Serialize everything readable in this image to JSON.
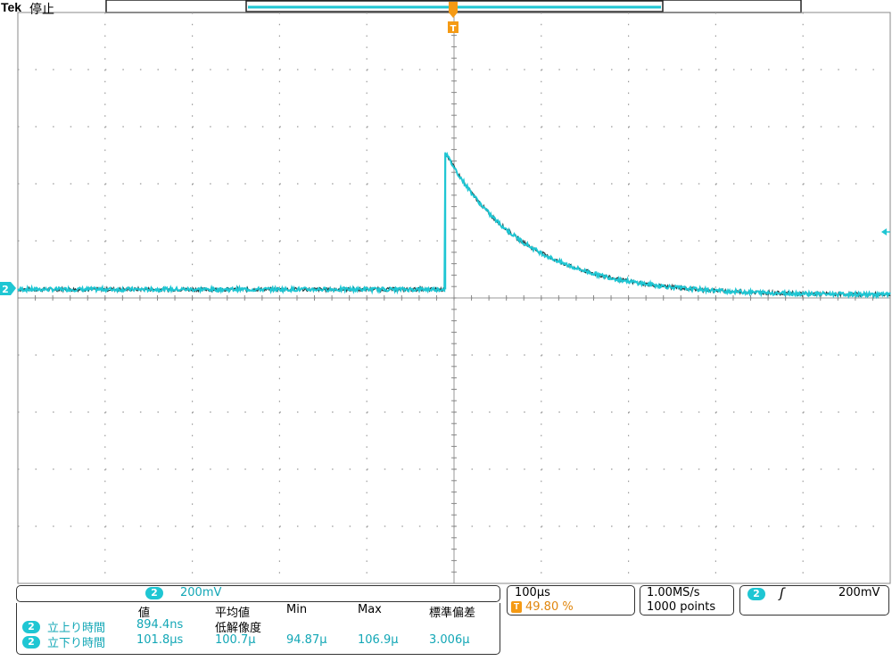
{
  "header": {
    "brand": "Tek",
    "status": "停止"
  },
  "channel": {
    "number": "2",
    "scale": "200mV",
    "color": "#1fc6d3"
  },
  "trigger": {
    "marker": "T",
    "position": "49.80 %",
    "level": "200mV",
    "slope_symbol": "ʃ"
  },
  "timebase": {
    "per_div": "100µs",
    "sample_rate": "1.00MS/s",
    "record_length": "1000 points"
  },
  "measurements": {
    "columns": [
      "値",
      "平均値",
      "Min",
      "Max",
      "標準偏差"
    ],
    "sub_header": "低解像度",
    "rows": [
      {
        "channel": "2",
        "name": "立上り時間",
        "value": "894.4ns",
        "mean": "",
        "min": "",
        "max": "",
        "std": ""
      },
      {
        "channel": "2",
        "name": "立下り時間",
        "value": "101.8µs",
        "mean": "100.7µ",
        "min": "94.87µ",
        "max": "106.9µ",
        "std": "3.006µ"
      }
    ]
  },
  "chart_data": {
    "type": "line",
    "title": "",
    "xlabel": "",
    "ylabel": "",
    "series": [
      {
        "channel": "2",
        "description_points": [
          {
            "x_div": 0.0,
            "y_div": 0.15
          },
          {
            "x_div": 4.9,
            "y_div": 0.15
          },
          {
            "x_div": 4.9,
            "y_div": 2.55
          },
          {
            "x_div": 10.0,
            "y_div": 0.05
          }
        ]
      }
    ],
    "decay": {
      "baseline_div": 0.05,
      "peak_div": 2.55,
      "tau_div": 0.9,
      "pre_level_div": 0.15
    },
    "grid": true,
    "x_divisions": 10,
    "y_divisions": 10,
    "xlim_div": [
      0,
      10
    ],
    "ylim_div": [
      -5,
      5
    ]
  }
}
